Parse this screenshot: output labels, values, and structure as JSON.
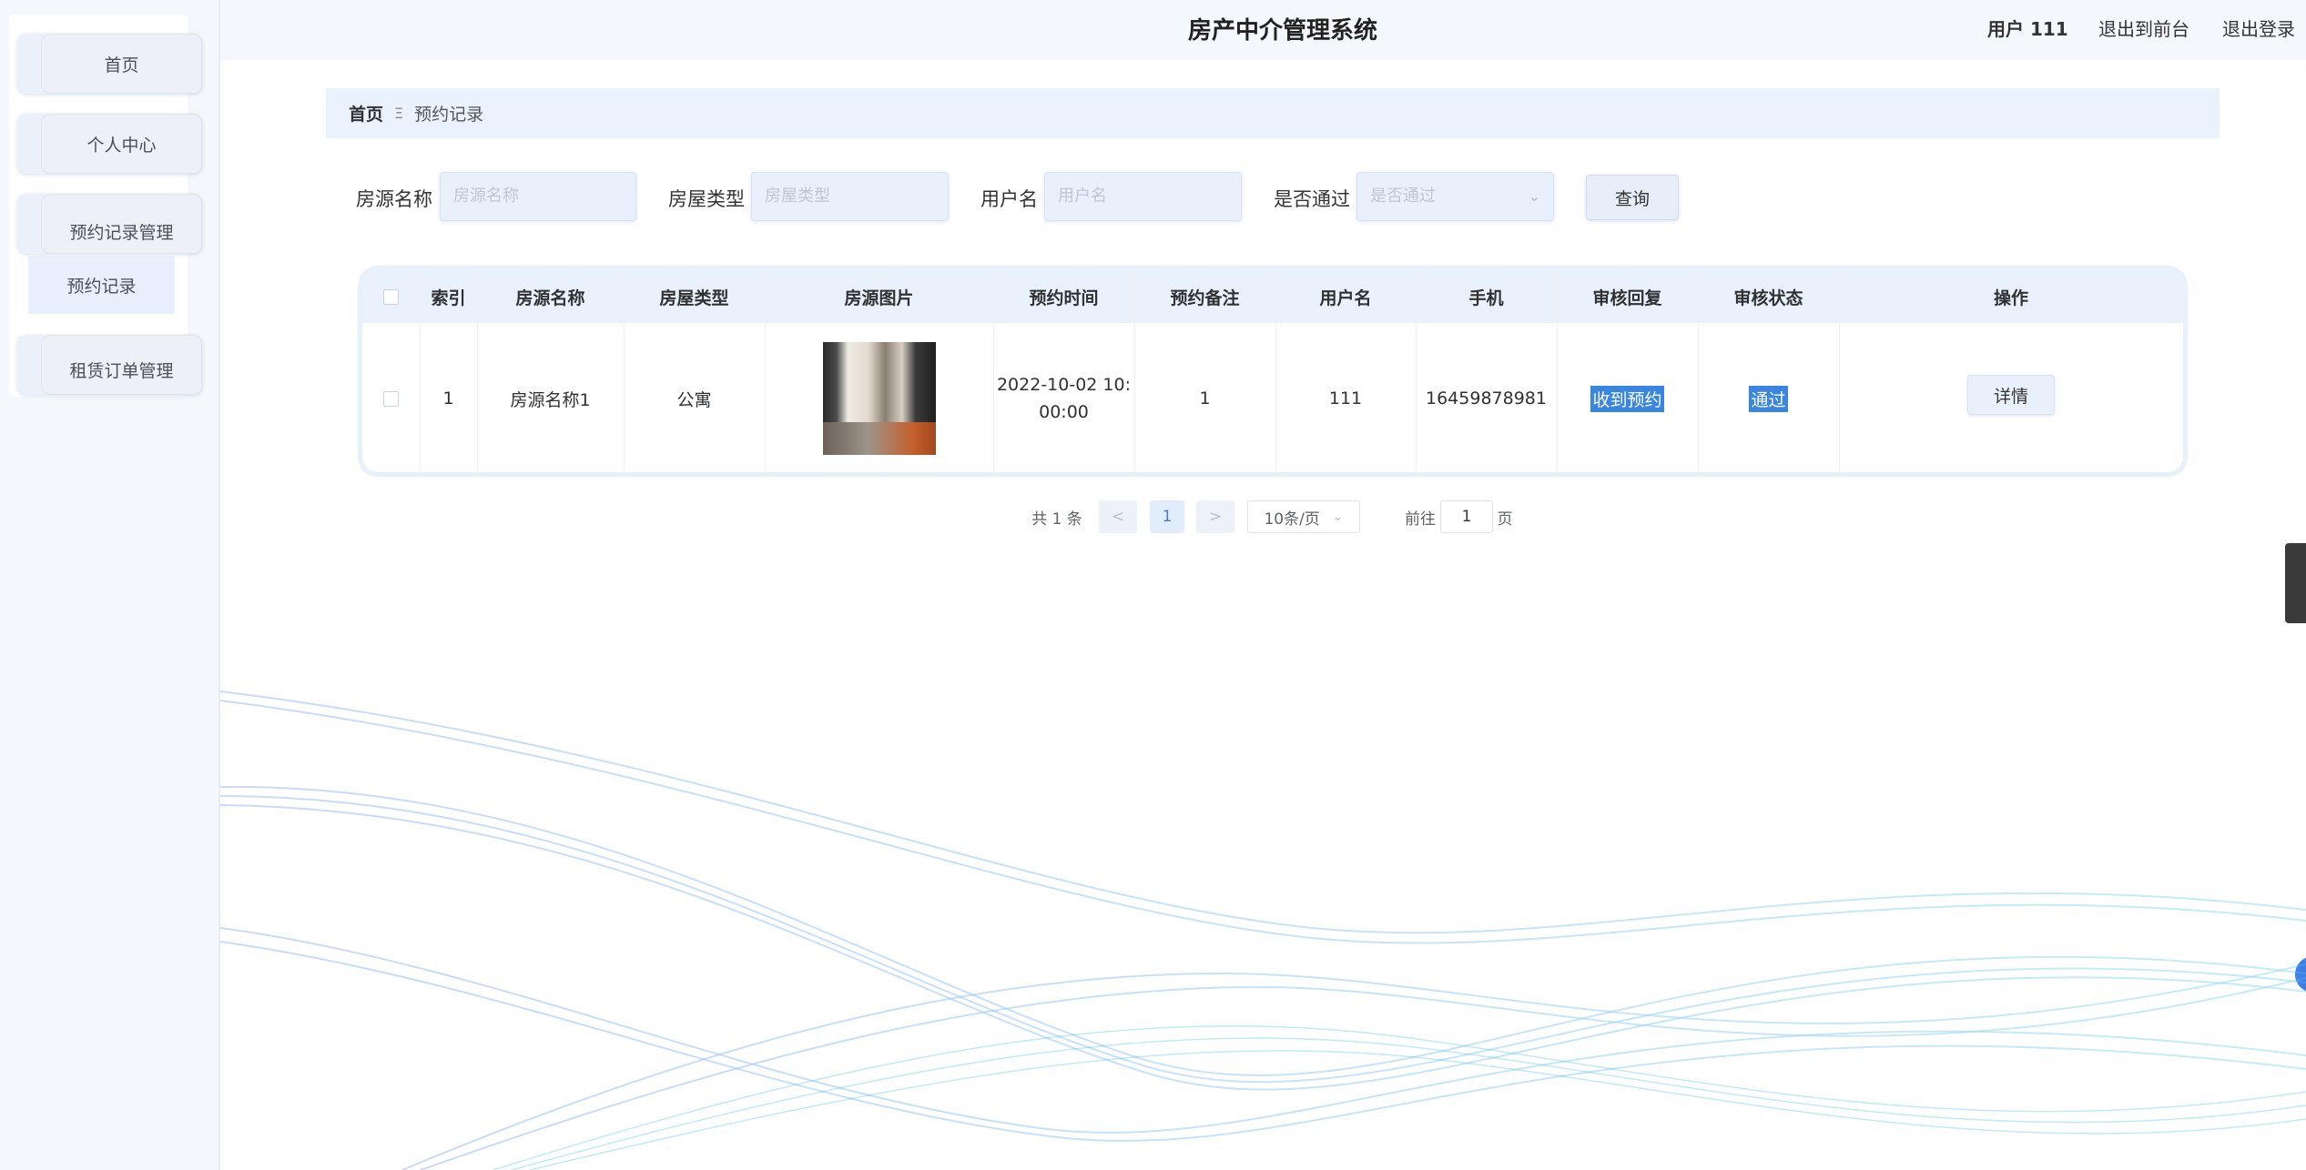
{
  "header": {
    "title": "房产中介管理系统",
    "user": "用户 111",
    "back_front": "退出到前台",
    "logout": "退出登录"
  },
  "sidebar": {
    "items": [
      {
        "label": "首页"
      },
      {
        "label": "个人中心"
      },
      {
        "label": "预约记录管理"
      },
      {
        "label": "租赁订单管理"
      }
    ],
    "sub_item": "预约记录"
  },
  "breadcrumb": {
    "home": "首页",
    "separator": "Ξ",
    "current": "预约记录"
  },
  "search": {
    "fields": [
      {
        "label": "房源名称",
        "placeholder": "房源名称"
      },
      {
        "label": "房屋类型",
        "placeholder": "房屋类型"
      },
      {
        "label": "用户名",
        "placeholder": "用户名"
      },
      {
        "label": "是否通过",
        "placeholder": "是否通过"
      }
    ],
    "query_button": "查询"
  },
  "table": {
    "headers": [
      "索引",
      "房源名称",
      "房屋类型",
      "房源图片",
      "预约时间",
      "预约备注",
      "用户名",
      "手机",
      "审核回复",
      "审核状态",
      "操作"
    ],
    "rows": [
      {
        "index": "1",
        "name": "房源名称1",
        "type": "公寓",
        "time_line1": "2022-10-02 10:",
        "time_line2": "00:00",
        "remark": "1",
        "username": "111",
        "phone": "16459878981",
        "reply": "收到预约",
        "status": "通过",
        "action": "详情"
      }
    ]
  },
  "pagination": {
    "total": "共 1 条",
    "prev": "<",
    "current_page": "1",
    "next": ">",
    "page_size": "10条/页",
    "goto_label": "前往",
    "goto_value": "1",
    "page_suffix": "页"
  },
  "colors": {
    "accent": "#3a85e0",
    "header_bg": "#f4f8fd",
    "sidebar_bg": "#f4f8fc"
  }
}
